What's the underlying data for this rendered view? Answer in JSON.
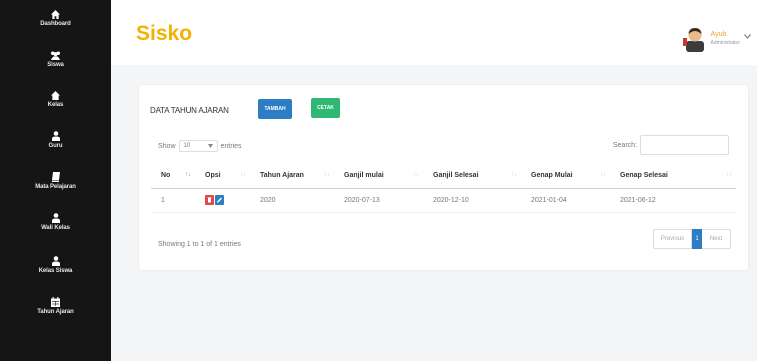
{
  "sidebar": {
    "items": [
      {
        "label": "Dashboard",
        "icon": "home-icon"
      },
      {
        "label": "Siswa",
        "icon": "users-icon"
      },
      {
        "label": "Kelas",
        "icon": "house-icon"
      },
      {
        "label": "Guru",
        "icon": "user-icon"
      },
      {
        "label": "Mata Pelajaran",
        "icon": "book-icon"
      },
      {
        "label": "Wali Kelas",
        "icon": "user-icon"
      },
      {
        "label": "Kelas Siswa",
        "icon": "user-icon"
      },
      {
        "label": "Tahun Ajaran",
        "icon": "calendar-icon"
      }
    ]
  },
  "header": {
    "brand": "Sisko",
    "user_name": "Ayub",
    "user_role": "Administrator"
  },
  "card": {
    "title": "DATA TAHUN AJARAN",
    "add_label": "TAMBAH",
    "print_label": "CETAK",
    "show_label": "Show",
    "entries_value": "10",
    "entries_label": "entries",
    "search_label": "Search:",
    "columns": [
      "No",
      "Opsi",
      "Tahun Ajaran",
      "Ganjil mulai",
      "Ganjil Selesai",
      "Genap Mulai",
      "Genap Selesai"
    ],
    "rows": [
      {
        "no": "1",
        "tahun": "2020",
        "ganjil_mulai": "2020-07-13",
        "ganjil_selesai": "2020-12-10",
        "genap_mulai": "2021-01-04",
        "genap_selesai": "2021-06-12"
      }
    ],
    "info": "Showing 1 to 1 of 1 entries",
    "pager": {
      "prev": "Previous",
      "current": "1",
      "next": "Next"
    }
  },
  "colors": {
    "sidebar_bg": "#151515",
    "brand": "#f0b400",
    "primary": "#2d7dc4",
    "success": "#2fb873",
    "danger": "#e04848"
  }
}
